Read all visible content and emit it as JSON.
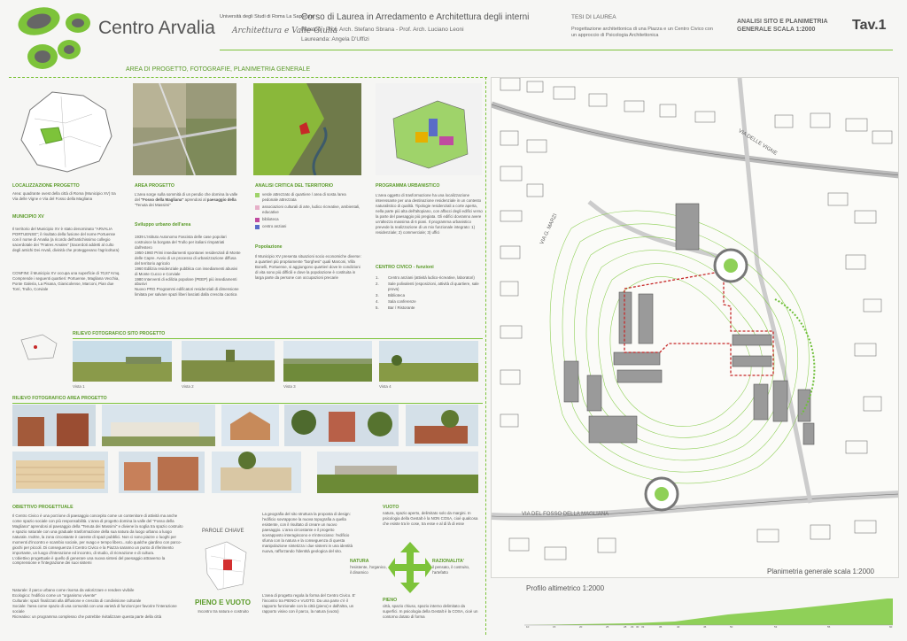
{
  "header": {
    "title": "Centro Arvalia",
    "university": "Università degli Studi di Roma La Sapienza",
    "signature": "Architettura e Valle Giulia",
    "course": "Corso di Laurea  in Arredamento e Architettura degli interni",
    "relatori": "Relatori : Prof. Arch. Stefano Sbrana - Prof. Arch. Luciano Leoni",
    "laureanda": "Laureanda: Angela D'Uffizi",
    "tesi": "TESI DI LAUREA",
    "tesi_desc": "Progettazione architettonica di una Piazza e un Centro Civico con un approccio di Psicologia Architettonica",
    "analisi_1": "ANALISI SITO E PLANIMETRIA",
    "analisi_2": "GENERALE     SCALA 1:2000",
    "tav": "Tav.1"
  },
  "colors": {
    "accent": "#7dc33a",
    "dark_green": "#5a9a28"
  },
  "section": {
    "title": "AREA DI PROGETTO, FOTOGRAFIE, PLANIMETRIA GENERALE"
  },
  "col1": {
    "h1": "LOCALIZZAZIONE PROGETTO",
    "t1": "Area: quadrante ovest della città di Roma (Municipio XV) tra Via delle Vigne e Via del Fosso della Magliana",
    "h2": "MUNICIPIO XV",
    "t2": "Il territorio del Municipio XV è stato denominato \"ARVALIA PORTUENSE\"; il risultato della fusione del nome Portuense con il nome di Arvalia (a ricordo dell'antichissimo collegio sacerdotale dei \"Fratres Arvales\" (Sacerdoti addetti al culto degli antichi Dei Arvali, divinità che proteggevano l'agricoltura)",
    "t3": "CONFINI:  il Municipio XV occupa una superficie di 70,87 Kmq. Comprende i seguenti quartieri: Portuense, Magliana Vecchia, Ponte Galeria, La Pisana, Gianicolense, Marconi, Pian due Torri, Trullo, Corviale"
  },
  "col2": {
    "h1": "AREA PROGETTO",
    "t1a": "L'area sorge sulla sommità di un pendio che domina la valle del ",
    "t1b": "\"Fosso della Magliana\"",
    "t1c": " aprendosi al ",
    "t1d": "paesaggio della",
    "t1e": " \"Tenuta dei Massimi\"",
    "h2": "Sviluppo urbano dell'area",
    "t2": "1939 L'Istituto Autonomo Fascista delle case popolari costruisce la borgata del Trullo per italiani rimpatriati dall'estero\n1950-1960 Primi insediamenti spontanei residenziali di Monte delle Capre. Avvio di un processo di urbanizzazione diffusa del territorio agricolo\n1960 Edilizia residenziale pubblica con insediamenti abusivi di Monte Cucco e Corviale\n1980 Interventi di edilizia popolare (PEEP) più insediamenti abusivi\nNuovo PRG Programmi edificatori residenziali di dimensione limitata per salvare spazi liberi lasciati dalla crescita caotica"
  },
  "col3": {
    "h1": "ANALISI CRITICA DEL TERRITORIO",
    "legend": [
      {
        "text": "verde attrezzato di quartiere / area di sosta /area pedonale attrezzata",
        "color": "#9fd36a"
      },
      {
        "text": "associazioni culturali di arte, ludico ricreative, ambientali, educative",
        "color": "#e6b0c8"
      },
      {
        "text": "biblioteca",
        "color": "#c04ba0"
      },
      {
        "text": "centro anziani",
        "color": "#5a6cc8"
      }
    ],
    "h2": "Popolazione",
    "t2": "Il Municipio XV presenta situazioni socio economiche diverse: a quartieri più propriamente \"borghesi\" quali Marconi, Villa Bonelli, Portuense, si aggiungono quartieri dove le condizioni di vita sono più difficili e dove la popolazione è costituita in larga parte da persone con occupazioni precarie"
  },
  "col4": {
    "h1": "PROGRAMMA URBANISTICO",
    "t1": "L'area oggetto di trasformazione ha una localizzazione interessante per una destinazione residenziale in un contesto naturalistico di qualità. Tipologie residenziali a corte aperta, nella parte più alta dell'altopiano, con affacci degli edifici verso la parte del paesaggio più pregiata. Gli edifici dovranno avere un'altezza massima di 6 piani. Il programma urbanistico prevede la realizzazione di un mix funzionale integrato: 1) residenziale; 2) commerciale; 3) uffici",
    "h2": "CENTRO CIVICO - funzioni",
    "items": [
      "Centro anziani (attività ludico-ricreative, laboratori)",
      "Sale polivalenti (esposizioni, attività di quartiere, sale prova)",
      "Biblioteca",
      "Sala conferenze",
      "Bar / Ristorante"
    ],
    "nums": [
      "1.",
      "2.",
      "3.",
      "4.",
      "5."
    ]
  },
  "rilievo": {
    "title": "RILIEVO FOTOGRAFICO SITO PROGETTO",
    "views": [
      "Vista 1",
      "Vista 2",
      "Vista 3",
      "Vista 4"
    ],
    "title2": "RILIEVO FOTOGRAFICO AREA PROGETTO"
  },
  "obiettivo": {
    "h": "OBIETTIVO PROGETTUALE",
    "t1": "Il Centro Civico è una porzione di paesaggio concepito come un contenitore di attività ma anche come spazio sociale con più responsabilità. L'area di progetto domina la valle del \"Fosso della Magliana\" aprendosi al paesaggio della \"Tenuta dei Massimi\" e diviene la soglia tra spazio costruito e spazio naturale con una graduale trasformazione della sua natura da luogo urbano a luogo naturale. Inoltre, la zona circostante è carente di spazi pubblici. Non ci sono piazze o luoghi per momenti d'incontro e scambio sociale, per svago e tempo libero...solo qualche giardino con parco-giochi per piccoli. Di conseguenza il Centro Civico e la Piazza saranno un punto di riferimento importante, un luogo d'interazione ed incontro, di studio, di ricreazione e di cultura.\nL'obiettivo progettuale è quello di generare una nuova sintesi del paesaggio attraverso la comprensione e l'integrazione dei suoi sistemi",
    "t2": "Naturale: il parco urbano come risorsa da valorizzare e rendere vivibile\nEcologico: l'edificio come un \"organismo vivente\"\nCulturale: spazi finalizzati alla diffusione e crescita di condivisione culturale\nSociale: l'area come spazio di una comunità con una varietà di funzioni per favorire l'interazione sociale\nRicreativo: un programma complesso che potrebbe rivitalizzare questa parte della città",
    "parole": "PAROLE CHIAVE",
    "pieno": "PIENO E VUOTO",
    "incontro": "Incontro tra natura e costruito",
    "geo": "La geografia del sito struttura la proposta di design: l'edificio sovrappone la nuova topografia a quella esistente, con il risultato di creare un nuovo paesaggio. L'area circostante e il progetto sovrapposto interagiscono e s'intrecciano: l'edificio sfuma con la natura e la conseguenza di questa manipolazione sintetizza i due sistemi in una identità nuova, rafforzando l'identità geologica del sito.",
    "regola": "L'area di progetto regola la forma del Centro Civico. E' l'incontro tra PIENO e VUOTO. Da una parte c'è il rapporto funzionale con la città (pieno) e dall'altra, un rapporto visivo con il parco, la natura (vuoto)",
    "vuoto_h": "VUOTO",
    "vuoto_t": "natura, spazio aperto, delimitato solo da margini. In psicologia della Gestalt è la NON COSA, cioè qualcosa che esiste tra le cose, tra esse e al di là di esse",
    "natura_h": "NATURA",
    "natura_t": "l'esistente, l'organico, il dinamico",
    "raz_h": "RAZIONALITA'",
    "raz_t": "il pensato, il costruito, l'artefatto",
    "pieno_h": "PIENO",
    "pieno_t": "città, spazio chiuso, spazio interno delimitato da superfici. In psicologia della Gestalt è la COSA, cioè un contorno dotato di forma"
  },
  "map": {
    "road1": "VIA DELLE VIGNE",
    "road2": "VIA G. MARZI",
    "road3": "VIA DEL FOSSO DELLA MAGLIANA",
    "scale": "Planimetria generale scala 1:2000",
    "profile": "Profilo altimetrico 1:2000"
  },
  "profile_ticks": [
    "10",
    "15",
    "20",
    "25",
    "28",
    "29",
    "30",
    "33",
    "35",
    "40",
    "45",
    "50",
    "53",
    "55",
    "60"
  ]
}
